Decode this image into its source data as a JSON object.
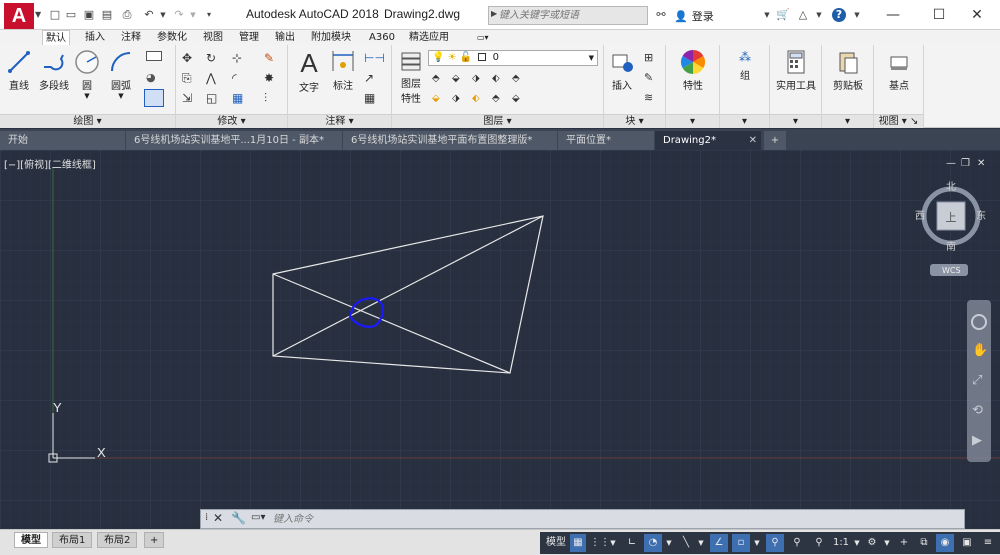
{
  "titlebar": {
    "logo": "A",
    "app_title": "Autodesk AutoCAD 2018",
    "file_name": "Drawing2.dwg",
    "search_placeholder": "键入关键字或短语",
    "login": "登录",
    "help": "?"
  },
  "ribbon_tabs": [
    "默认",
    "插入",
    "注释",
    "参数化",
    "视图",
    "管理",
    "输出",
    "附加模块",
    "A360",
    "精选应用"
  ],
  "ribbon": {
    "draw": {
      "title": "绘图",
      "line": "直线",
      "polyline": "多段线",
      "circle": "圆",
      "arc": "圆弧"
    },
    "modify": {
      "title": "修改"
    },
    "annotate": {
      "title": "注释",
      "text": "文字",
      "dimension": "标注"
    },
    "layers": {
      "title": "图层",
      "layer_props": "图层\n特性",
      "layer_props_1": "图层",
      "layer_props_2": "特性",
      "layer_value": "0"
    },
    "block": {
      "title": "块",
      "insert": "插入"
    },
    "properties": {
      "label": "特性"
    },
    "group": {
      "label": "组"
    },
    "utilities": {
      "label": "实用工具"
    },
    "clipboard": {
      "label": "剪贴板"
    },
    "view": {
      "title": "视图",
      "base": "基点"
    }
  },
  "doc_tabs": [
    {
      "label": "开始"
    },
    {
      "label": "6号线机场站实训基地平...1月10日 - 副本*"
    },
    {
      "label": "6号线机场站实训基地平面布置图整理版*"
    },
    {
      "label": "平面位置*"
    },
    {
      "label": "Drawing2*"
    }
  ],
  "drawing": {
    "view_label": "[−][俯视][二维线框]",
    "compass": {
      "north": "北",
      "south": "南",
      "east": "东",
      "west": "西",
      "top": "上"
    },
    "wcs": "WCS",
    "axis_x": "X",
    "axis_y": "Y"
  },
  "command": {
    "placeholder": "键入命令"
  },
  "layout_tabs": [
    "模型",
    "布局1",
    "布局2"
  ],
  "status": {
    "model": "模型",
    "scale": "1:1"
  },
  "colors": {
    "background": "#283040",
    "geometry": "#e8e8e8",
    "selection": "#1a1aff",
    "accent": "#c8102e"
  }
}
